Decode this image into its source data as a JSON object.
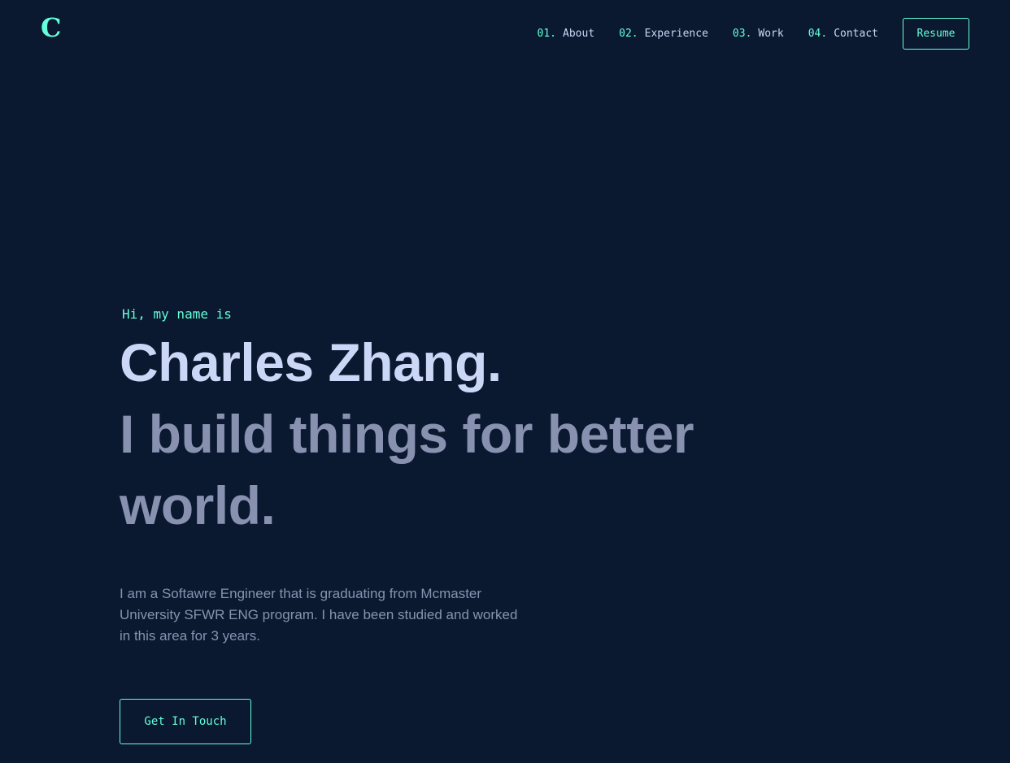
{
  "brand": {
    "logo_letter": "C"
  },
  "nav": {
    "items": [
      {
        "number": "01.",
        "label": "About"
      },
      {
        "number": "02.",
        "label": "Experience"
      },
      {
        "number": "03.",
        "label": "Work"
      },
      {
        "number": "04.",
        "label": "Contact"
      }
    ],
    "resume_label": "Resume"
  },
  "hero": {
    "greeting": "Hi, my name is",
    "name": "Charles Zhang.",
    "tagline": "I build things for better world.",
    "bio": "I am a Softawre Engineer that is graduating from Mcmaster University SFWR ENG program. I have been studied and worked in this area for 3 years.",
    "cta_label": "Get In Touch"
  },
  "colors": {
    "background": "#0a192f",
    "accent": "#64ffda",
    "heading": "#ccd6f6",
    "muted": "#8892b0"
  }
}
